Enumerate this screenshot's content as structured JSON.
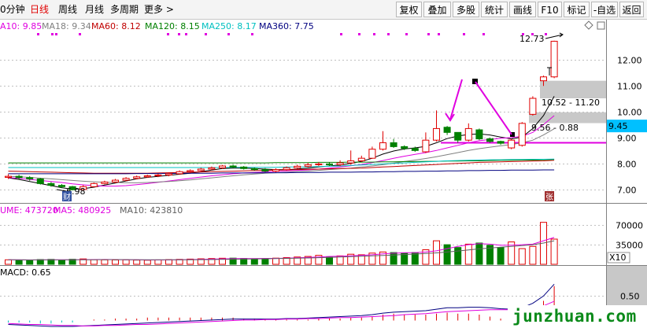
{
  "toolbar": {
    "left_tabs": [
      {
        "label": "0分钟",
        "active": false
      },
      {
        "label": "日线",
        "active": true
      },
      {
        "label": "周线",
        "active": false
      },
      {
        "label": "月线",
        "active": false
      },
      {
        "label": "多周期",
        "active": false
      },
      {
        "label": "更多 >",
        "active": false
      }
    ],
    "right_buttons": [
      "复权",
      "叠加",
      "多股",
      "统计",
      "画线",
      "F10",
      "标记",
      "-自选",
      "返回"
    ]
  },
  "chart_data": {
    "type": "candlestick",
    "ma_legend": [
      {
        "label": "A10: 9.85",
        "color": "#e000e0"
      },
      {
        "label": "MA18: 9.34",
        "color": "#808080"
      },
      {
        "label": "MA60: 8.12",
        "color": "#c00000"
      },
      {
        "label": "MA120: 8.15",
        "color": "#008000"
      },
      {
        "label": "MA250: 8.17",
        "color": "#00c0c0"
      },
      {
        "label": "MA360: 7.75",
        "color": "#000080"
      }
    ],
    "price_axis": {
      "ticks": [
        "12.00",
        "11.00",
        "10.00",
        "9.00",
        "8.00",
        "7.00"
      ],
      "min": 6.5,
      "max": 13.2
    },
    "current_price": "9.45",
    "annotations": {
      "high_label": "12.73",
      "low_label": "6.98",
      "zone_upper": "10.52 - 11.20",
      "zone_lower": "9.56 - 0.88",
      "badge_cai": "财",
      "badge_zhang": "张"
    },
    "candles": [
      [
        7.46,
        7.5,
        7.58,
        7.4
      ],
      [
        7.5,
        7.45,
        7.56,
        7.38
      ],
      [
        7.45,
        7.4,
        7.51,
        7.33
      ],
      [
        7.4,
        7.22,
        7.44,
        7.18
      ],
      [
        7.22,
        7.15,
        7.28,
        7.1
      ],
      [
        7.15,
        7.1,
        7.2,
        7.04
      ],
      [
        7.1,
        6.98,
        7.13,
        6.96
      ],
      [
        6.99,
        7.1,
        7.16,
        6.97
      ],
      [
        7.1,
        7.22,
        7.26,
        7.08
      ],
      [
        7.22,
        7.28,
        7.33,
        7.19
      ],
      [
        7.28,
        7.35,
        7.4,
        7.24
      ],
      [
        7.35,
        7.42,
        7.47,
        7.31
      ],
      [
        7.42,
        7.48,
        7.53,
        7.38
      ],
      [
        7.48,
        7.52,
        7.56,
        7.44
      ],
      [
        7.52,
        7.55,
        7.6,
        7.47
      ],
      [
        7.55,
        7.6,
        7.65,
        7.5
      ],
      [
        7.6,
        7.68,
        7.73,
        7.56
      ],
      [
        7.68,
        7.72,
        7.77,
        7.63
      ],
      [
        7.72,
        7.78,
        7.83,
        7.68
      ],
      [
        7.78,
        7.83,
        7.88,
        7.74
      ],
      [
        7.83,
        7.9,
        7.94,
        7.79
      ],
      [
        7.9,
        7.86,
        7.95,
        7.82
      ],
      [
        7.86,
        7.8,
        7.9,
        7.76
      ],
      [
        7.8,
        7.76,
        7.84,
        7.72
      ],
      [
        7.76,
        7.7,
        7.82,
        7.66
      ],
      [
        7.7,
        7.76,
        7.81,
        7.66
      ],
      [
        7.76,
        7.83,
        7.88,
        7.72
      ],
      [
        7.83,
        7.89,
        7.95,
        7.79
      ],
      [
        7.89,
        7.95,
        8.02,
        7.85
      ],
      [
        7.95,
        7.98,
        8.05,
        7.9
      ],
      [
        7.98,
        7.95,
        8.05,
        7.9
      ],
      [
        7.95,
        8.02,
        8.12,
        7.9
      ],
      [
        8.02,
        8.1,
        8.5,
        7.95
      ],
      [
        8.1,
        8.2,
        8.3,
        8.05
      ],
      [
        8.2,
        8.55,
        8.65,
        8.18
      ],
      [
        8.55,
        8.8,
        9.25,
        8.5
      ],
      [
        8.8,
        8.65,
        8.95,
        8.6
      ],
      [
        8.65,
        8.58,
        8.7,
        8.52
      ],
      [
        8.58,
        8.5,
        8.65,
        8.45
      ],
      [
        8.45,
        8.9,
        9.2,
        8.4
      ],
      [
        8.9,
        9.35,
        10.05,
        8.85
      ],
      [
        9.4,
        9.2,
        9.45,
        9.1
      ],
      [
        9.2,
        8.9,
        9.1,
        8.8
      ],
      [
        8.9,
        9.35,
        9.55,
        8.85
      ],
      [
        9.3,
        8.95,
        9.35,
        8.9
      ],
      [
        8.95,
        8.85,
        9.0,
        8.8
      ],
      [
        8.85,
        8.78,
        8.88,
        8.72
      ],
      [
        8.6,
        8.9,
        8.95,
        8.55
      ],
      [
        8.7,
        9.55,
        9.6,
        8.65
      ],
      [
        9.9,
        10.52,
        10.6,
        9.85
      ],
      [
        11.2,
        11.35,
        11.4,
        11.0
      ],
      [
        11.35,
        12.73,
        12.75,
        11.3
      ]
    ],
    "moving_averages": {
      "ma5": [
        7.44,
        7.38,
        7.3,
        7.22,
        7.14,
        7.06,
        7.0,
        7.02,
        7.08,
        7.16,
        7.24,
        7.32,
        7.4,
        7.46,
        7.5,
        7.54,
        7.58,
        7.62,
        7.68,
        7.74,
        7.8,
        7.82,
        7.82,
        7.8,
        7.78,
        7.76,
        7.76,
        7.78,
        7.82,
        7.86,
        7.9,
        7.94,
        8.0,
        8.08,
        8.2,
        8.36,
        8.48,
        8.56,
        8.6,
        8.66,
        8.8,
        8.96,
        9.06,
        9.12,
        9.14,
        9.1,
        9.02,
        8.95,
        9.02,
        9.35,
        9.85,
        10.6
      ],
      "ma10": [
        7.45,
        7.42,
        7.38,
        7.34,
        7.3,
        7.26,
        7.21,
        7.17,
        7.14,
        7.12,
        7.12,
        7.14,
        7.18,
        7.22,
        7.27,
        7.32,
        7.37,
        7.42,
        7.47,
        7.52,
        7.56,
        7.6,
        7.63,
        7.65,
        7.67,
        7.69,
        7.71,
        7.73,
        7.75,
        7.78,
        7.82,
        7.86,
        7.91,
        7.96,
        8.03,
        8.11,
        8.2,
        8.28,
        8.35,
        8.42,
        8.5,
        8.6,
        8.7,
        8.8,
        8.88,
        8.93,
        8.97,
        9.0,
        9.05,
        9.2,
        9.5,
        9.85
      ],
      "ma18": [
        7.5,
        7.48,
        7.46,
        7.43,
        7.4,
        7.37,
        7.34,
        7.31,
        7.29,
        7.27,
        7.26,
        7.25,
        7.25,
        7.26,
        7.28,
        7.3,
        7.33,
        7.36,
        7.4,
        7.44,
        7.48,
        7.52,
        7.56,
        7.59,
        7.62,
        7.64,
        7.66,
        7.68,
        7.7,
        7.73,
        7.76,
        7.79,
        7.82,
        7.86,
        7.9,
        7.95,
        8.01,
        8.07,
        8.13,
        8.19,
        8.26,
        8.34,
        8.42,
        8.5,
        8.57,
        8.63,
        8.68,
        8.73,
        8.8,
        8.9,
        9.1,
        9.34
      ],
      "ma60": [
        7.7,
        7.69,
        7.68,
        7.67,
        7.66,
        7.65,
        7.64,
        7.63,
        7.62,
        7.62,
        7.62,
        7.62,
        7.62,
        7.62,
        7.63,
        7.64,
        7.65,
        7.66,
        7.67,
        7.68,
        7.69,
        7.7,
        7.71,
        7.72,
        7.73,
        7.74,
        7.75,
        7.76,
        7.77,
        7.78,
        7.79,
        7.8,
        7.81,
        7.82,
        7.84,
        7.86,
        7.88,
        7.9,
        7.92,
        7.94,
        7.96,
        7.98,
        8.0,
        8.02,
        8.04,
        8.05,
        8.06,
        8.07,
        8.08,
        8.09,
        8.1,
        8.12
      ],
      "ma120": [
        8.02,
        8.02,
        8.02,
        8.02,
        8.02,
        8.02,
        8.02,
        8.02,
        8.02,
        8.02,
        8.02,
        8.02,
        8.02,
        8.02,
        8.02,
        8.02,
        8.02,
        8.02,
        8.02,
        8.02,
        8.02,
        8.02,
        8.02,
        8.02,
        8.02,
        8.03,
        8.03,
        8.03,
        8.03,
        8.04,
        8.04,
        8.04,
        8.05,
        8.05,
        8.05,
        8.06,
        8.06,
        8.07,
        8.07,
        8.08,
        8.08,
        8.09,
        8.09,
        8.1,
        8.1,
        8.11,
        8.12,
        8.12,
        8.13,
        8.13,
        8.14,
        8.15
      ],
      "ma250": [
        7.84,
        7.84,
        7.84,
        7.84,
        7.84,
        7.84,
        7.84,
        7.84,
        7.84,
        7.84,
        7.84,
        7.84,
        7.84,
        7.84,
        7.84,
        7.84,
        7.84,
        7.84,
        7.84,
        7.84,
        7.84,
        7.85,
        7.85,
        7.85,
        7.85,
        7.85,
        7.86,
        7.86,
        7.87,
        7.88,
        7.89,
        7.9,
        7.92,
        7.94,
        7.96,
        7.98,
        8.0,
        8.02,
        8.04,
        8.06,
        8.08,
        8.1,
        8.11,
        8.12,
        8.13,
        8.14,
        8.14,
        8.15,
        8.15,
        8.16,
        8.16,
        8.17
      ],
      "ma360": [
        7.6,
        7.6,
        7.6,
        7.6,
        7.6,
        7.6,
        7.6,
        7.6,
        7.6,
        7.6,
        7.6,
        7.6,
        7.61,
        7.61,
        7.61,
        7.61,
        7.62,
        7.62,
        7.62,
        7.62,
        7.63,
        7.63,
        7.63,
        7.63,
        7.64,
        7.64,
        7.64,
        7.65,
        7.65,
        7.65,
        7.66,
        7.66,
        7.66,
        7.67,
        7.67,
        7.68,
        7.68,
        7.69,
        7.69,
        7.7,
        7.7,
        7.71,
        7.71,
        7.72,
        7.72,
        7.73,
        7.73,
        7.74,
        7.74,
        7.74,
        7.75,
        7.75
      ]
    },
    "volume": {
      "legend": [
        {
          "label": "UME: 473720",
          "color": "#e000e0"
        },
        {
          "label": "MA5: 480925",
          "color": "#e000e0"
        },
        {
          "label": "MA10: 423810",
          "color": "#606060"
        }
      ],
      "axis_ticks": [
        "70000",
        "35000"
      ],
      "unit_label": "X10",
      "max": 90000,
      "values": [
        8000,
        7500,
        7200,
        8500,
        8800,
        7600,
        9000,
        9600,
        8200,
        8000,
        7800,
        8000,
        7500,
        7300,
        7800,
        8300,
        8800,
        9300,
        9800,
        10300,
        10800,
        11000,
        10500,
        10000,
        10200,
        11000,
        12000,
        13000,
        14000,
        16000,
        13000,
        15000,
        18000,
        17000,
        20000,
        22000,
        21000,
        20500,
        21000,
        26000,
        42000,
        35000,
        30000,
        36000,
        38000,
        34000,
        30000,
        40000,
        28000,
        32000,
        75000,
        45000
      ],
      "ma5": [
        8000,
        7900,
        7800,
        7900,
        8000,
        8000,
        8100,
        8300,
        8500,
        8600,
        8500,
        8200,
        8000,
        7800,
        7700,
        7800,
        8000,
        8400,
        8800,
        9300,
        9700,
        10000,
        10200,
        10300,
        10500,
        10600,
        11000,
        11500,
        12200,
        13000,
        14000,
        14500,
        15000,
        16000,
        17000,
        18500,
        19800,
        20500,
        21000,
        22000,
        24000,
        28000,
        32000,
        35000,
        37000,
        36000,
        34000,
        34000,
        35000,
        36000,
        42000,
        48000
      ],
      "ma10": [
        8000,
        8000,
        7900,
        7900,
        7900,
        7900,
        8000,
        8100,
        8200,
        8300,
        8300,
        8300,
        8200,
        8100,
        8000,
        8000,
        8000,
        8100,
        8300,
        8500,
        8700,
        9000,
        9300,
        9600,
        9900,
        10200,
        10500,
        10900,
        11300,
        11800,
        12400,
        13000,
        13600,
        14300,
        15000,
        15800,
        16600,
        17500,
        18300,
        19200,
        20400,
        22000,
        23800,
        25700,
        27500,
        29000,
        30500,
        32000,
        33500,
        35000,
        38000,
        42000
      ]
    },
    "macd": {
      "legend": "MACD: 0.65",
      "axis_ticks": [
        "0.50"
      ],
      "range": [
        -0.12,
        1.0
      ],
      "dif": [
        -0.08,
        -0.09,
        -0.1,
        -0.11,
        -0.12,
        -0.12,
        -0.12,
        -0.11,
        -0.1,
        -0.09,
        -0.08,
        -0.07,
        -0.06,
        -0.05,
        -0.04,
        -0.03,
        -0.02,
        -0.01,
        0.0,
        0.01,
        0.02,
        0.03,
        0.03,
        0.03,
        0.03,
        0.03,
        0.04,
        0.04,
        0.05,
        0.06,
        0.07,
        0.08,
        0.09,
        0.1,
        0.12,
        0.15,
        0.17,
        0.18,
        0.19,
        0.2,
        0.23,
        0.26,
        0.26,
        0.27,
        0.27,
        0.26,
        0.24,
        0.23,
        0.26,
        0.35,
        0.5,
        0.74
      ],
      "dea": [
        -0.06,
        -0.07,
        -0.08,
        -0.08,
        -0.09,
        -0.1,
        -0.1,
        -0.11,
        -0.11,
        -0.1,
        -0.1,
        -0.09,
        -0.08,
        -0.08,
        -0.07,
        -0.06,
        -0.05,
        -0.04,
        -0.03,
        -0.02,
        -0.01,
        0.0,
        0.01,
        0.01,
        0.02,
        0.02,
        0.03,
        0.03,
        0.04,
        0.04,
        0.05,
        0.06,
        0.06,
        0.07,
        0.08,
        0.09,
        0.1,
        0.12,
        0.13,
        0.14,
        0.16,
        0.18,
        0.19,
        0.2,
        0.21,
        0.22,
        0.22,
        0.22,
        0.23,
        0.25,
        0.3,
        0.39
      ]
    }
  }
}
